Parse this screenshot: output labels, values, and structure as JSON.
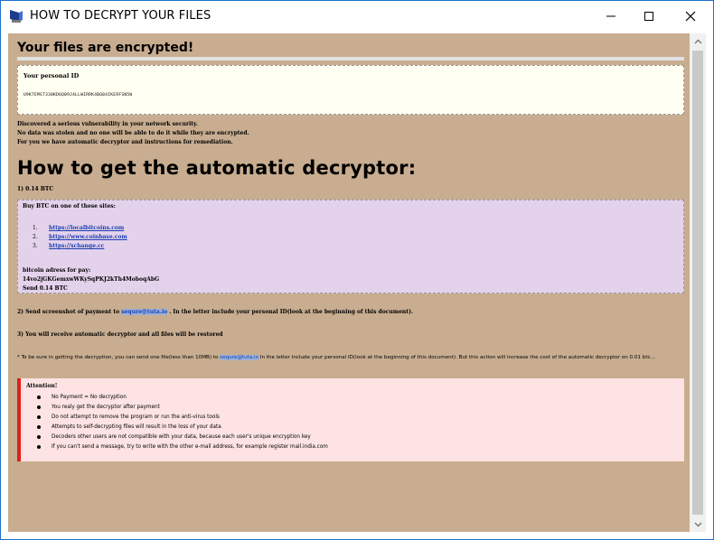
{
  "window": {
    "title": "HOW TO DECRYPT YOUR FILES",
    "colors": {
      "border": "#1c73c9",
      "background": "#c8ad90"
    }
  },
  "main": {
    "heading": "Your files are encrypted!",
    "personal_id": {
      "label": "Your personal ID",
      "value": "U9K7EMST338KD6Q09J4LLWIRRK4BQ04IKERFSN5W"
    },
    "intro_lines": [
      "Discovered a serious vulnerability in your network security.",
      "No data was stolen and no one will be able to do it while they are encrypted.",
      "For you we have automatic decryptor and instructions for remediation."
    ],
    "section_title": "How to get the automatic decryptor:",
    "step1": "1) 0.14 BTC",
    "buy": {
      "heading": "Buy BTC on one of these sites:",
      "sites": [
        {
          "num": "1.",
          "url": "https://localbitcoins.com"
        },
        {
          "num": "2.",
          "url": "https://www.coinbase.com"
        },
        {
          "num": "3.",
          "url": "https://xchange.cc"
        }
      ],
      "address_label": "bitcoin adress for pay:",
      "address": "14vo2jGKGemxwWKySqPKJ2kTh4MoboqAbG",
      "send": "Send 0.14 BTC"
    },
    "step2": {
      "prefix": "2) Send screenshot of payment to",
      "email": "sequre@tuta.io",
      "suffix": ". In the letter include your personal ID(look at the beginning of this document)."
    },
    "step3": "3) You will receive automatic decryptor and all files will be restored",
    "note": {
      "prefix": "* To be sure in getting the decryption, you can send one file(less than 10MB) to",
      "email": "sequre@tuta.io",
      "suffix": "In the letter include your personal ID(look at the beginning of this document). But this action will increase the cost of the automatic decryptor on 0.01 btc..."
    },
    "attention": {
      "title": "Attention!",
      "items": [
        "No Payment = No decryption",
        "You realy get the decryptor after payment",
        "Do not attempt to remove the program or run the anti-virus tools",
        "Attempts to self-decrypting files will result in the loss of your data",
        "Decoders other users are not compatible with your data, because each user's unique encryption key",
        "If you can't send a message, try to write with the other e-mail address, for example register mail.india.com"
      ]
    }
  }
}
